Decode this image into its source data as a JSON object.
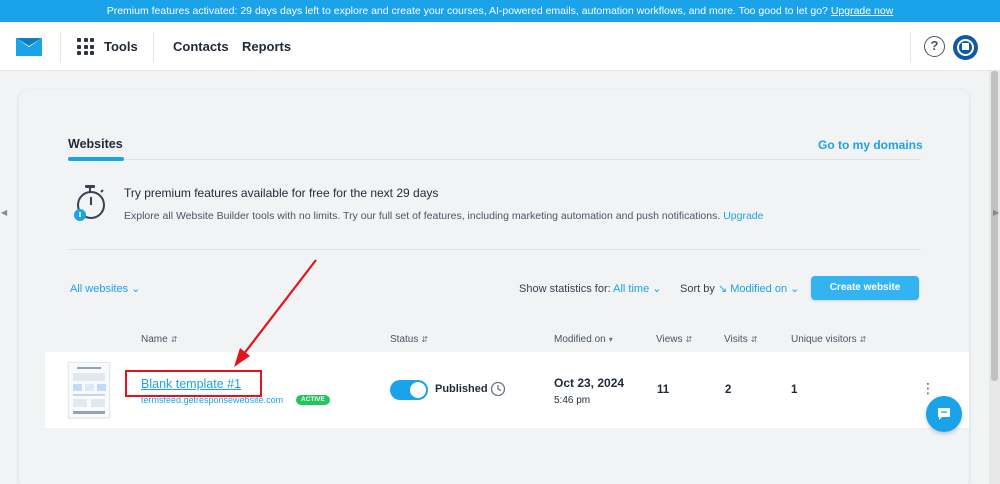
{
  "promo": {
    "text": "Premium features activated: 29 days days left to explore and create your courses, AI-powered emails, automation workflows, and more. Too good to let go?",
    "link": "Upgrade now"
  },
  "nav": {
    "tools": "Tools",
    "contacts": "Contacts",
    "reports": "Reports",
    "help": "?"
  },
  "tabs": {
    "websites": "Websites",
    "domains_link": "Go to my domains"
  },
  "premium": {
    "title": "Try premium features available for free for the next 29 days",
    "desc": "Explore all Website Builder tools with no limits. Try our full set of features, including marketing automation and push notifications.",
    "upgrade": "Upgrade"
  },
  "filters": {
    "all_websites": "All websites",
    "show_stats_label": "Show statistics for:",
    "show_stats_value": "All time",
    "sort_label": "Sort by",
    "sort_value": "Modified on",
    "create_button": "Create website"
  },
  "table": {
    "headers": {
      "name": "Name",
      "status": "Status",
      "modified": "Modified on",
      "views": "Views",
      "visits": "Visits",
      "unique": "Unique visitors"
    },
    "rows": [
      {
        "name": "Blank template #1",
        "url": "termsfeed.getresponsewebsite.com",
        "badge": "ACTIVE",
        "status": "Published",
        "date": "Oct 23, 2024",
        "time": "5:46 pm",
        "views": "11",
        "visits": "2",
        "unique": "1"
      }
    ]
  },
  "colors": {
    "accent": "#1aa3e8",
    "highlight": "#e1141b",
    "badge": "#22c55e"
  }
}
